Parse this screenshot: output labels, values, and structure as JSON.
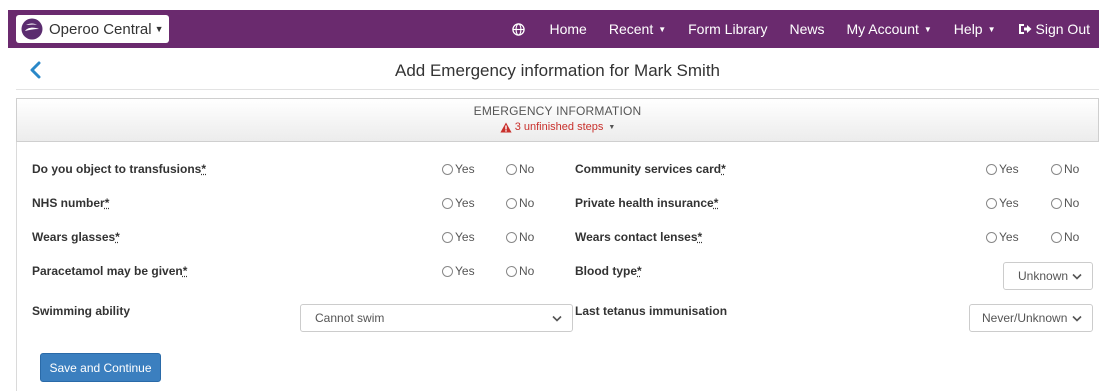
{
  "brand": {
    "label": "Operoo Central"
  },
  "nav": {
    "home": "Home",
    "recent": "Recent",
    "form_library": "Form Library",
    "news": "News",
    "my_account": "My Account",
    "help": "Help",
    "sign_out": "Sign Out"
  },
  "page": {
    "title": "Add Emergency information for Mark Smith"
  },
  "section": {
    "title": "EMERGENCY INFORMATION",
    "steps": "3 unfinished steps"
  },
  "radio_options": {
    "yes": "Yes",
    "no": "No"
  },
  "fields": {
    "transfusions": "Do you object to transfusions",
    "nhs_number": "NHS number",
    "wears_glasses": "Wears glasses",
    "paracetamol": "Paracetamol may be given",
    "swimming": "Swimming ability",
    "community_card": "Community services card",
    "private_insurance": "Private health insurance",
    "contact_lenses": "Wears contact lenses",
    "blood_type": "Blood type",
    "tetanus": "Last tetanus immunisation"
  },
  "required_marker": "*",
  "selects": {
    "swimming": "Cannot swim",
    "blood_type": "Unknown",
    "tetanus": "Never/Unknown"
  },
  "button": {
    "save": "Save and Continue"
  },
  "colors": {
    "navbar": "#6a2a6e",
    "primary": "#3b7fbf",
    "link": "#2a88c8",
    "warning": "#c9302c"
  },
  "icons": [
    "operoo-logo-icon",
    "globe-icon",
    "sign-out-icon",
    "back-chevron-icon",
    "warning-icon",
    "chevron-down-icon"
  ]
}
